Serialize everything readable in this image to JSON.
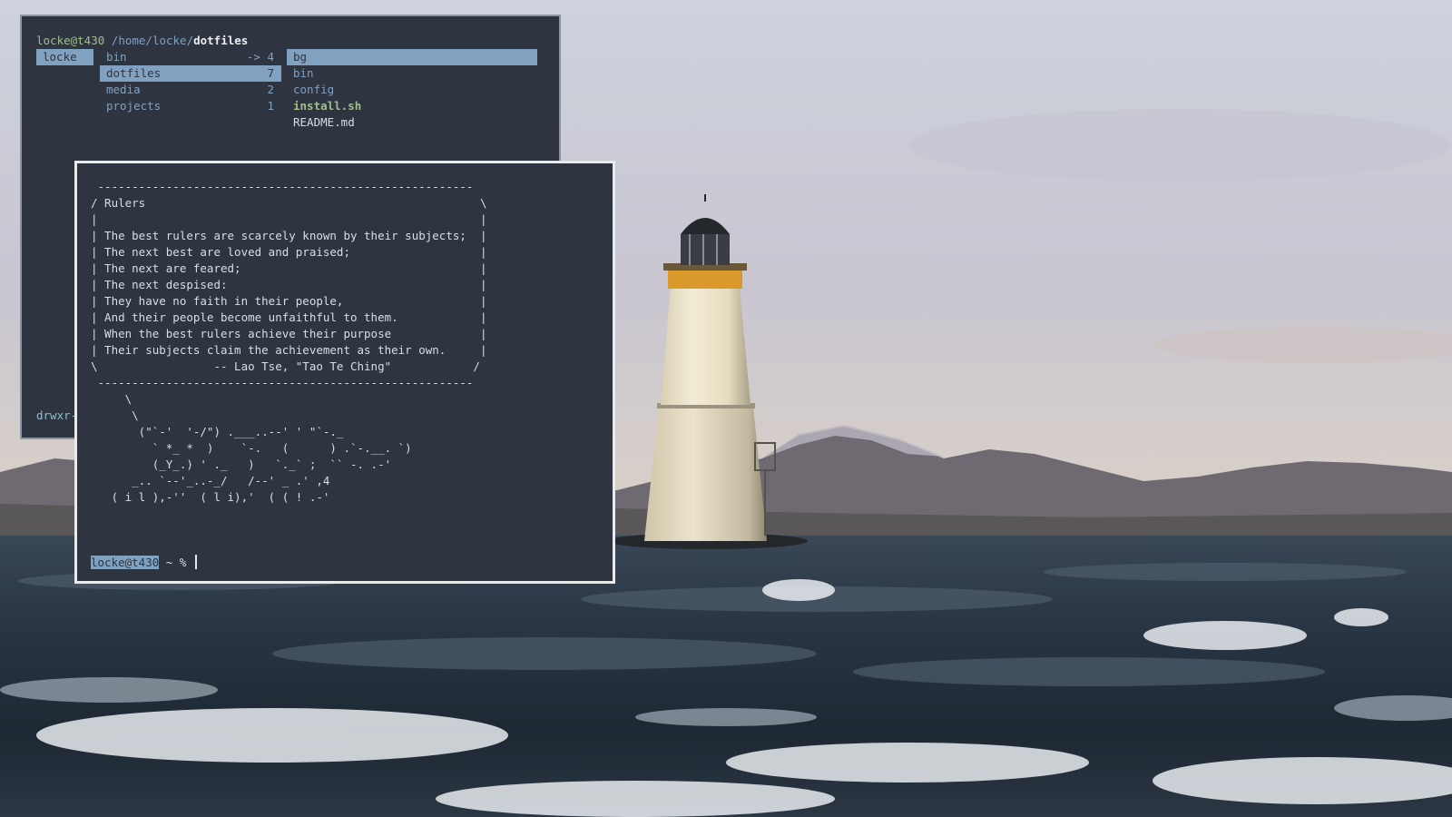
{
  "ranger": {
    "user_host": "locke@t430",
    "path_prefix": "/home/locke/",
    "path_current": "dotfiles",
    "parent_column": [
      {
        "name": "locke",
        "selected": true
      }
    ],
    "current_column": [
      {
        "name": "bin",
        "count": "-> 4",
        "selected": false
      },
      {
        "name": "dotfiles",
        "count": "7",
        "selected": true
      },
      {
        "name": "media",
        "count": "2",
        "selected": false
      },
      {
        "name": "projects",
        "count": "1",
        "selected": false
      }
    ],
    "preview_column": [
      {
        "name": "bg",
        "kind": "dir",
        "selected": true
      },
      {
        "name": "bin",
        "kind": "dir",
        "selected": false
      },
      {
        "name": "config",
        "kind": "dir",
        "selected": false
      },
      {
        "name": "install.sh",
        "kind": "exe",
        "selected": false
      },
      {
        "name": "README.md",
        "kind": "file",
        "selected": false
      }
    ],
    "status_line": "drwxr-"
  },
  "cowsay": {
    "lines": [
      " -------------------------------------------------------",
      "/ Rulers                                                 \\",
      "|                                                        |",
      "| The best rulers are scarcely known by their subjects;  |",
      "| The next best are loved and praised;                   |",
      "| The next are feared;                                   |",
      "| The next despised:                                     |",
      "| They have no faith in their people,                    |",
      "| And their people become unfaithful to them.            |",
      "| When the best rulers achieve their purpose             |",
      "| Their subjects claim the achievement as their own.     |",
      "\\                 -- Lao Tse, \"Tao Te Ching\"            /",
      " -------------------------------------------------------",
      "     \\",
      "      \\",
      "       (\"`-'  '-/\") .___..--' ' \"`-._",
      "         ` *_ *  )    `-.   (      ) .`-.__. `)",
      "         (_Y_.) ' ._   )   `._` ;  `` -. .-'",
      "      _.. `--'_..-_/   /--' _ .' ,4",
      "   ( i l ),-''  ( l i),'  ( ( ! .-'"
    ],
    "prompt_user": "locke@t430",
    "prompt_rest": " ~ % "
  },
  "colors": {
    "terminal_bg": "#2e3440",
    "accent": "#81a1c1",
    "green": "#a3be8c",
    "foreground": "#d8dee9"
  }
}
